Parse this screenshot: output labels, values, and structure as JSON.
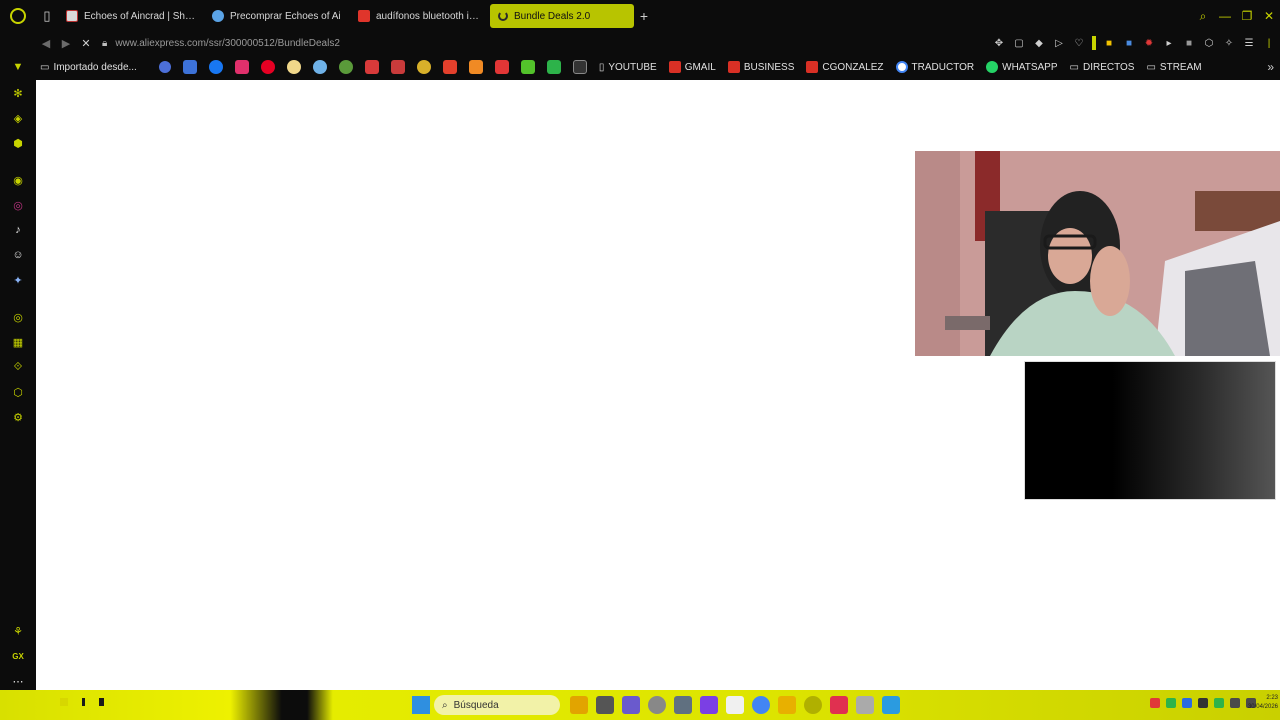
{
  "tabs": [
    {
      "title": "Echoes of Aincrad | Shop",
      "favicon": "store-icon",
      "color": "#d9d9d9"
    },
    {
      "title": "Precomprar Echoes of Ai",
      "favicon": "steam-icon",
      "color": "#5aa3e6"
    },
    {
      "title": "audífonos bluetooth in ear",
      "favicon": "aliexpress-icon",
      "color": "#e0352b"
    },
    {
      "title": "Bundle Deals 2.0",
      "favicon": "loading-spinner",
      "color": "#b8c400",
      "active": true
    }
  ],
  "new_tab_label": "+",
  "address_bar": {
    "url": "www.aliexpress.com/ssr/300000512/BundleDeals2"
  },
  "bookmarks": {
    "imported_folder": "Importado desde...",
    "items": [
      {
        "label": "YOUTUBE",
        "icon": "page-icon"
      },
      {
        "label": "GMAIL",
        "icon": "gmail-icon"
      },
      {
        "label": "BUSINESS",
        "icon": "gmail-icon"
      },
      {
        "label": "CGONZALEZ",
        "icon": "gmail-icon"
      },
      {
        "label": "TRADUCTOR",
        "icon": "google-icon"
      },
      {
        "label": "WHATSAPP",
        "icon": "whatsapp-icon"
      },
      {
        "label": "DIRECTOS",
        "icon": "folder-icon"
      },
      {
        "label": "STREAM",
        "icon": "folder-icon"
      }
    ]
  },
  "sidebar_bottom_label": "GX",
  "taskbar": {
    "search_placeholder": "Búsqueda",
    "clock_time": "2:23",
    "clock_date": "30/04/2026"
  },
  "colors": {
    "accent": "#c8d400",
    "page_bg": "#ffffff",
    "chrome_bg": "#0c0c0c"
  }
}
